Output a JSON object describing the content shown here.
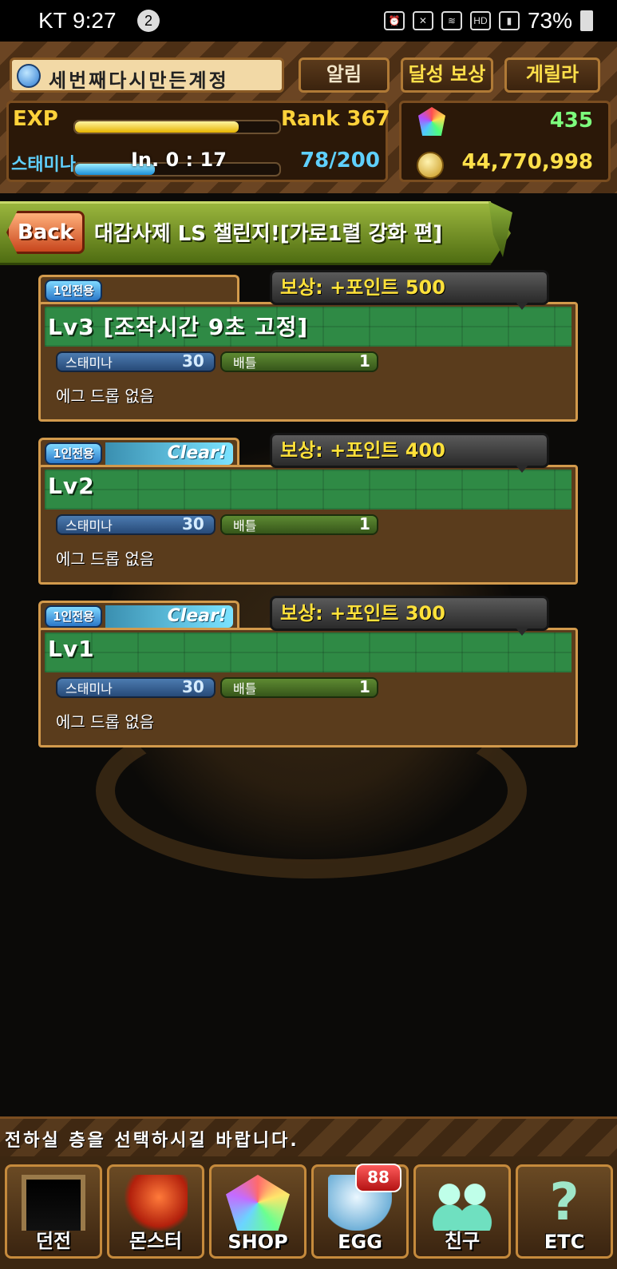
{
  "status_bar": {
    "carrier_time": "KT 9:27",
    "notification_count": "2",
    "hd_label": "HD",
    "battery": "73%"
  },
  "header": {
    "account_name": "세번째다시만든계정",
    "buttons": {
      "alarm": "알림",
      "achievement_reward": "달성 보상",
      "guerrilla": "게릴라"
    },
    "exp_label": "EXP",
    "exp_progress": 0.8,
    "rank": "Rank 367",
    "stamina_label": "스태미나",
    "stamina_timer": "In. 0 : 17",
    "stamina_value": "78/200",
    "stamina_progress": 0.39,
    "magic_stones": "435",
    "coins": "44,770,998"
  },
  "titlebar": {
    "back_label": "Back",
    "title": "대감사제 LS 챌린지![가로1렬 강화 편]"
  },
  "dungeons": [
    {
      "solo_label": "1인전용",
      "clear": "",
      "reward": "보상: +포인트 500",
      "name": "Lv3 [조작시간 9초 고정]",
      "stamina_label": "스태미나",
      "stamina": "30",
      "battle_label": "배틀",
      "battles": "1",
      "egg_note": "에그 드롭 없음"
    },
    {
      "solo_label": "1인전용",
      "clear": "Clear!",
      "reward": "보상: +포인트 400",
      "name": "Lv2",
      "stamina_label": "스태미나",
      "stamina": "30",
      "battle_label": "배틀",
      "battles": "1",
      "egg_note": "에그 드롭 없음"
    },
    {
      "solo_label": "1인전용",
      "clear": "Clear!",
      "reward": "보상: +포인트 300",
      "name": "Lv1",
      "stamina_label": "스태미나",
      "stamina": "30",
      "battle_label": "배틀",
      "battles": "1",
      "egg_note": "에그 드롭 없음"
    }
  ],
  "message": "전하실 층을 선택하시길 바랍니다.",
  "nav": {
    "dungeon": "던전",
    "monster": "몬스터",
    "shop": "SHOP",
    "egg": "EGG",
    "egg_badge": "88",
    "friend": "친구",
    "etc": "ETC"
  }
}
